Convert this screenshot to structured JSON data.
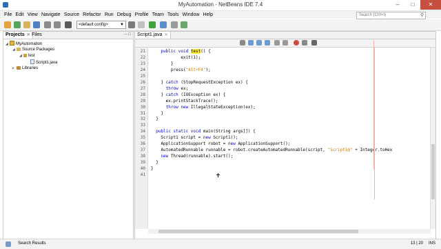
{
  "window": {
    "title": "MyAutomation - NetBeans IDE 7.4"
  },
  "menu": [
    "File",
    "Edit",
    "View",
    "Navigate",
    "Source",
    "Refactor",
    "Run",
    "Debug",
    "Profile",
    "Team",
    "Tools",
    "Window",
    "Help"
  ],
  "search": {
    "placeholder": "Search (Ctrl+I)"
  },
  "toolbar": {
    "config_value": "<default config>"
  },
  "left_panel": {
    "tabs": [
      "Projects",
      "Files"
    ],
    "tree": [
      {
        "label": "MyAutomation",
        "icon": "project-icon",
        "expanded": true
      },
      {
        "label": "Source Packages",
        "icon": "source-packages-icon",
        "expanded": true
      },
      {
        "label": "test",
        "icon": "package-icon",
        "expanded": true
      },
      {
        "label": "Script1.java",
        "icon": "java-file-icon"
      },
      {
        "label": "Libraries",
        "icon": "libraries-icon",
        "expanded": false
      }
    ]
  },
  "editor": {
    "tab_label": "Script1.java",
    "lines": [
      {
        "n": "21",
        "parts": [
          [
            "    ",
            ""
          ],
          [
            "public void ",
            "kw"
          ],
          [
            "test",
            "hl"
          ],
          [
            "() {",
            ""
          ]
        ]
      },
      {
        "n": "22",
        "parts": [
          [
            "            exit(1);",
            ""
          ]
        ]
      },
      {
        "n": "23",
        "parts": [
          [
            "        }",
            ""
          ]
        ]
      },
      {
        "n": "24",
        "parts": [
          [
            "        press(",
            ""
          ],
          [
            "\"Alt+F4\"",
            "str"
          ],
          [
            ");",
            ""
          ]
        ]
      },
      {
        "n": "25",
        "parts": [
          [
            "",
            ""
          ]
        ]
      },
      {
        "n": "26",
        "parts": [
          [
            "    } ",
            ""
          ],
          [
            "catch",
            "kw"
          ],
          [
            " (StopRequestException ex) {",
            ""
          ]
        ]
      },
      {
        "n": "27",
        "parts": [
          [
            "      ",
            ""
          ],
          [
            "throw",
            "kw"
          ],
          [
            " ex;",
            ""
          ]
        ]
      },
      {
        "n": "28",
        "parts": [
          [
            "    } ",
            ""
          ],
          [
            "catch",
            "kw"
          ],
          [
            " (IOException ex) {",
            ""
          ]
        ]
      },
      {
        "n": "29",
        "parts": [
          [
            "      ex.printStackTrace();",
            ""
          ]
        ]
      },
      {
        "n": "30",
        "parts": [
          [
            "      ",
            ""
          ],
          [
            "throw new",
            "kw"
          ],
          [
            " IllegalStateException(ex);",
            ""
          ]
        ]
      },
      {
        "n": "31",
        "parts": [
          [
            "    }",
            ""
          ]
        ]
      },
      {
        "n": "32",
        "parts": [
          [
            "  }",
            ""
          ]
        ]
      },
      {
        "n": "33",
        "parts": [
          [
            "",
            ""
          ]
        ]
      },
      {
        "n": "34",
        "parts": [
          [
            "  ",
            ""
          ],
          [
            "public static void",
            "kw"
          ],
          [
            " main(String args[]) {",
            ""
          ]
        ]
      },
      {
        "n": "35",
        "parts": [
          [
            "    Script1 script = ",
            ""
          ],
          [
            "new",
            "kw"
          ],
          [
            " Script1();",
            ""
          ]
        ]
      },
      {
        "n": "36",
        "parts": [
          [
            "    ApplicationSupport robot = ",
            ""
          ],
          [
            "new",
            "kw"
          ],
          [
            " ApplicationSupport();",
            ""
          ]
        ]
      },
      {
        "n": "37",
        "parts": [
          [
            "    AutomatedRunnable runnable = robot.createAutomatedRunnable(script, ",
            ""
          ],
          [
            "\"Script1@\"",
            "str"
          ],
          [
            " + Integer.toHex",
            ""
          ]
        ]
      },
      {
        "n": "38",
        "parts": [
          [
            "    ",
            ""
          ],
          [
            "new",
            "kw"
          ],
          [
            " Thread(runnable).start();",
            ""
          ]
        ]
      },
      {
        "n": "39",
        "parts": [
          [
            "  }",
            ""
          ]
        ]
      },
      {
        "n": "40",
        "parts": [
          [
            "}",
            ""
          ]
        ]
      },
      {
        "n": "41",
        "parts": [
          [
            "",
            ""
          ]
        ]
      }
    ]
  },
  "status": {
    "left": "Search Results",
    "position": "13 | 20",
    "mode": "INS"
  },
  "colors": {
    "keyword": "#0000c8",
    "string": "#ce7b00",
    "highlight": "#ffeb3b",
    "close_button": "#c74f3f"
  }
}
